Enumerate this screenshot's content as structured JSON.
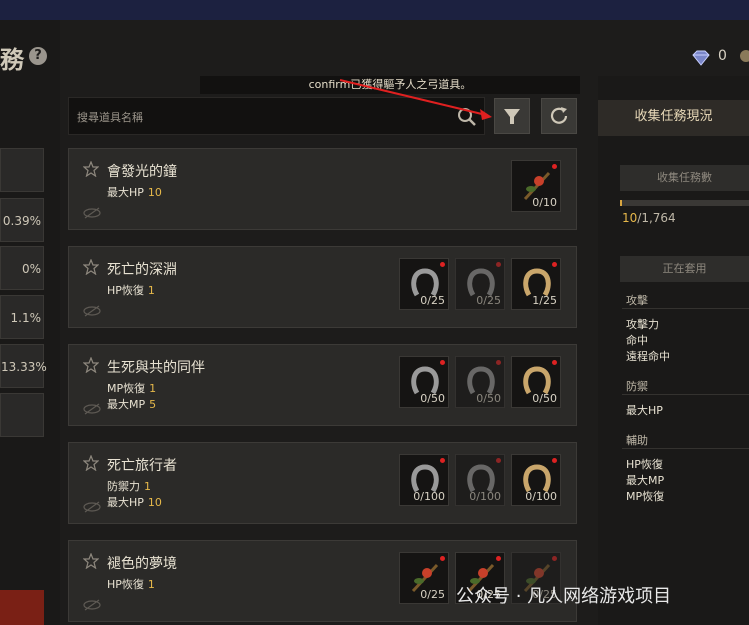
{
  "header": {
    "title": "務",
    "help": "?"
  },
  "currency": {
    "diamond_value": "0"
  },
  "notice": "confirm已獲得驅予人之弓道具。",
  "search": {
    "placeholder": "搜尋道具名稱"
  },
  "left_stats": [
    "0.39%",
    "0%",
    "1.1%",
    "13.33%"
  ],
  "cards": [
    {
      "name": "會發光的鐘",
      "stats": [
        {
          "label": "最大HP",
          "value": "10"
        }
      ],
      "slots": [
        {
          "count": "0/10",
          "dim": false,
          "dot": true,
          "icon": "branch-icon"
        }
      ]
    },
    {
      "name": "死亡的深淵",
      "stats": [
        {
          "label": "HP恢復",
          "value": "1"
        }
      ],
      "slots": [
        {
          "count": "0/25",
          "dim": false,
          "dot": true,
          "icon": "horseshoe-icon"
        },
        {
          "count": "0/25",
          "dim": true,
          "dot": true,
          "icon": "horseshoe-icon"
        },
        {
          "count": "1/25",
          "dim": false,
          "dot": true,
          "icon": "horseshoe-gold-icon"
        }
      ]
    },
    {
      "name": "生死與共的同伴",
      "stats": [
        {
          "label": "MP恢復",
          "value": "1"
        },
        {
          "label": "最大MP",
          "value": "5"
        }
      ],
      "slots": [
        {
          "count": "0/50",
          "dim": false,
          "dot": true,
          "icon": "horseshoe-icon"
        },
        {
          "count": "0/50",
          "dim": true,
          "dot": true,
          "icon": "horseshoe-icon"
        },
        {
          "count": "0/50",
          "dim": false,
          "dot": true,
          "icon": "horseshoe-gold-icon"
        }
      ]
    },
    {
      "name": "死亡旅行者",
      "stats": [
        {
          "label": "防禦力",
          "value": "1"
        },
        {
          "label": "最大HP",
          "value": "10"
        }
      ],
      "slots": [
        {
          "count": "0/100",
          "dim": false,
          "dot": true,
          "icon": "horseshoe-icon"
        },
        {
          "count": "0/100",
          "dim": true,
          "dot": true,
          "icon": "horseshoe-icon"
        },
        {
          "count": "0/100",
          "dim": false,
          "dot": true,
          "icon": "horseshoe-gold-icon"
        }
      ]
    },
    {
      "name": "褪色的夢境",
      "stats": [
        {
          "label": "HP恢復",
          "value": "1"
        }
      ],
      "slots": [
        {
          "count": "0/25",
          "dim": false,
          "dot": true,
          "icon": "branch-icon"
        },
        {
          "count": "0/25",
          "dim": false,
          "dot": true,
          "icon": "branch-icon"
        },
        {
          "count": "0/25",
          "dim": true,
          "dot": true,
          "icon": "branch-icon"
        }
      ]
    }
  ],
  "right": {
    "title": "收集任務現況",
    "bar1": "收集任務數",
    "progress_current": "10",
    "progress_total": "/1,764",
    "progress_fraction": 0.006,
    "bar2": "正在套用",
    "sections": [
      {
        "title": "攻擊",
        "items": [
          "攻擊力",
          "命中",
          "遠程命中"
        ]
      },
      {
        "title": "防禦",
        "items": [
          "最大HP"
        ]
      },
      {
        "title": "輔助",
        "items": [
          "HP恢復",
          "最大MP",
          "MP恢復"
        ]
      }
    ]
  },
  "watermark": "公众号 · 凡人网络游戏项目",
  "colors": {
    "accent": "#e6b84a",
    "alert_dot": "#dd2222",
    "arrow": "#e02020"
  }
}
